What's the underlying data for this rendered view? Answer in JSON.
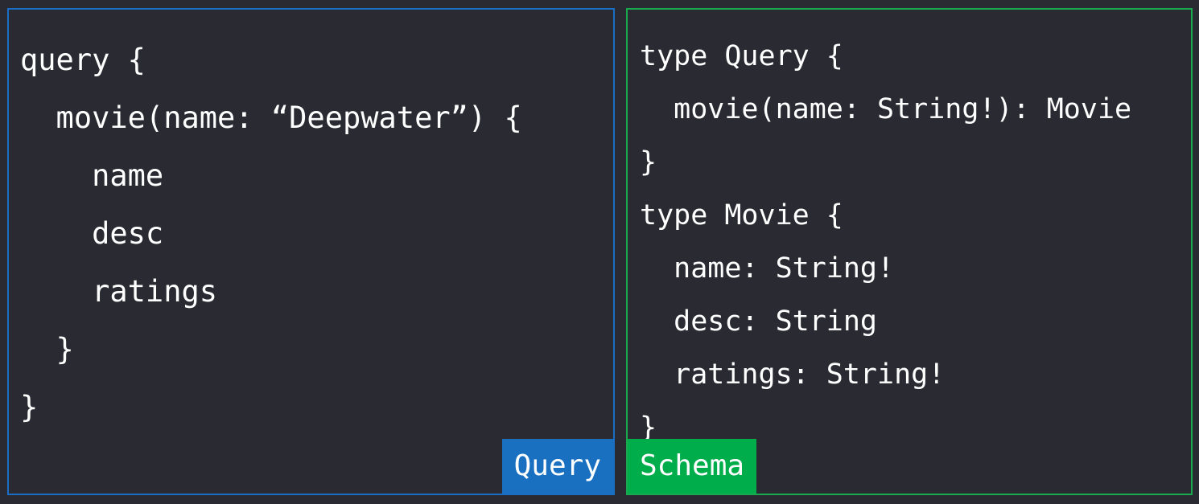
{
  "query_panel": {
    "label": "Query",
    "border_color": "#1a6fc4",
    "lines": [
      "query {",
      "  movie(name: “Deepwater”) {",
      "    name",
      "    desc",
      "    ratings",
      "  }",
      "}"
    ]
  },
  "schema_panel": {
    "label": "Schema",
    "border_color": "#19a94f",
    "lines": [
      "type Query {",
      "  movie(name: String!): Movie",
      "}",
      "type Movie {",
      "  name: String!",
      "  desc: String",
      "  ratings: String!",
      "}"
    ]
  }
}
